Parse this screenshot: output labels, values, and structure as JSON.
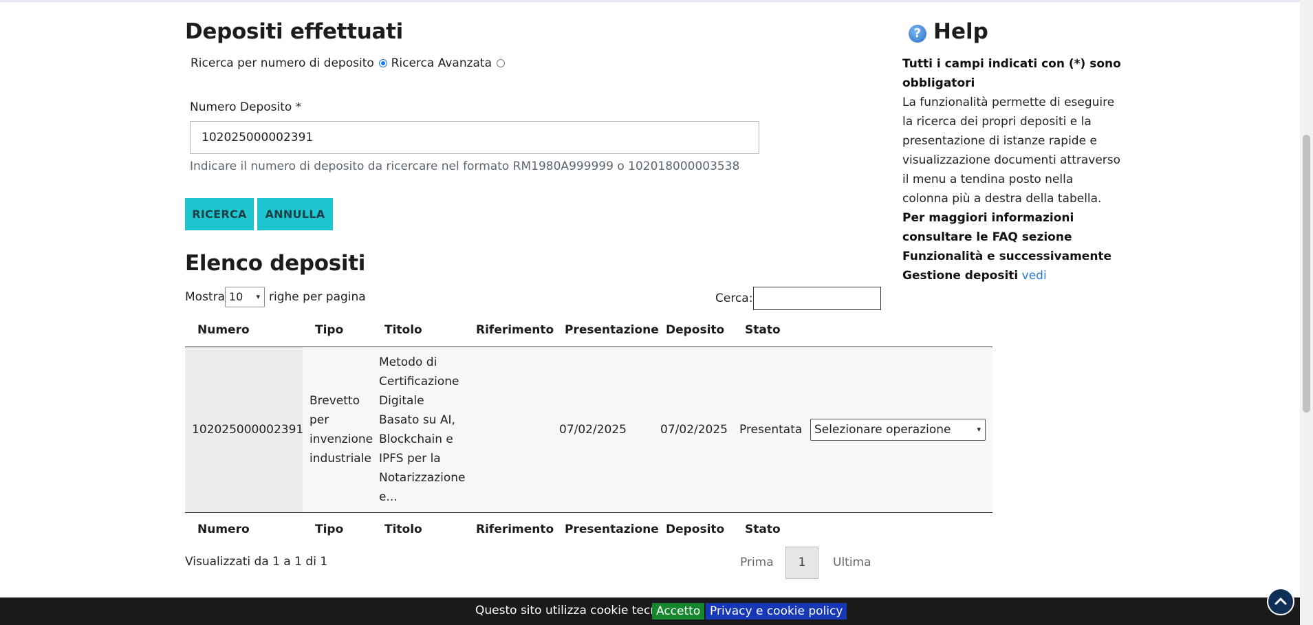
{
  "page": {
    "title": "Depositi effettuati",
    "radio_numero_label": "Ricerca per numero di deposito",
    "radio_avanzata_label": "Ricerca Avanzata",
    "field_label": "Numero Deposito *",
    "field_value": "102025000002391",
    "hint": "Indicare il numero di deposito da ricercare nel formato RM1980A999999 o 102018000003538",
    "btn_ricerca": "RICERCA",
    "btn_annulla": "ANNULLA",
    "list_title": "Elenco depositi",
    "mostra": "Mostra",
    "page_size": "10",
    "righe": "righe per pagina",
    "cerca": "Cerca:"
  },
  "table": {
    "headers": [
      "Numero",
      "Tipo",
      "Titolo",
      "Riferimento",
      "Presentazione",
      "Deposito",
      "Stato"
    ],
    "row": {
      "numero": "102025000002391",
      "tipo": [
        "Brevetto",
        "per",
        "invenzione",
        "industriale"
      ],
      "titolo": [
        "Metodo di",
        "Certificazione",
        "Digitale",
        "Basato su AI,",
        "Blockchain e",
        "IPFS per la",
        "Notarizzazione",
        "e..."
      ],
      "riferimento": "",
      "presentazione": "07/02/2025",
      "deposito": "07/02/2025",
      "stato": "Presentata",
      "operazione": "Selezionare operazione"
    }
  },
  "pagination": {
    "info": "Visualizzati da 1 a 1 di 1",
    "prima": "Prima",
    "current": "1",
    "ultima": "Ultima"
  },
  "help": {
    "title": "Help",
    "required": "Tutti i campi indicati con (*) sono obbligatori",
    "description": "La funzionalità permette di eseguire la ricerca dei propri depositi e la presentazione di istanze rapide e visualizzazione documenti attraverso il menu a tendina posto nella colonna più a destra della tabella.",
    "more_info": "Per maggiori informazioni consultare le FAQ sezione Funzionalità e successivamente Gestione depositi",
    "link": "vedi"
  },
  "cookie": {
    "text": "Questo sito utilizza cookie tecnici",
    "accept": "Accetto",
    "policy": "Privacy e cookie policy"
  },
  "icons": {
    "help": "help-icon",
    "to_top": "chevron-up-icon"
  },
  "colors": {
    "button": "#1ec7cf",
    "link": "#2a7ad6",
    "cookie_accept": "#16862f",
    "cookie_policy": "#1637b6"
  }
}
